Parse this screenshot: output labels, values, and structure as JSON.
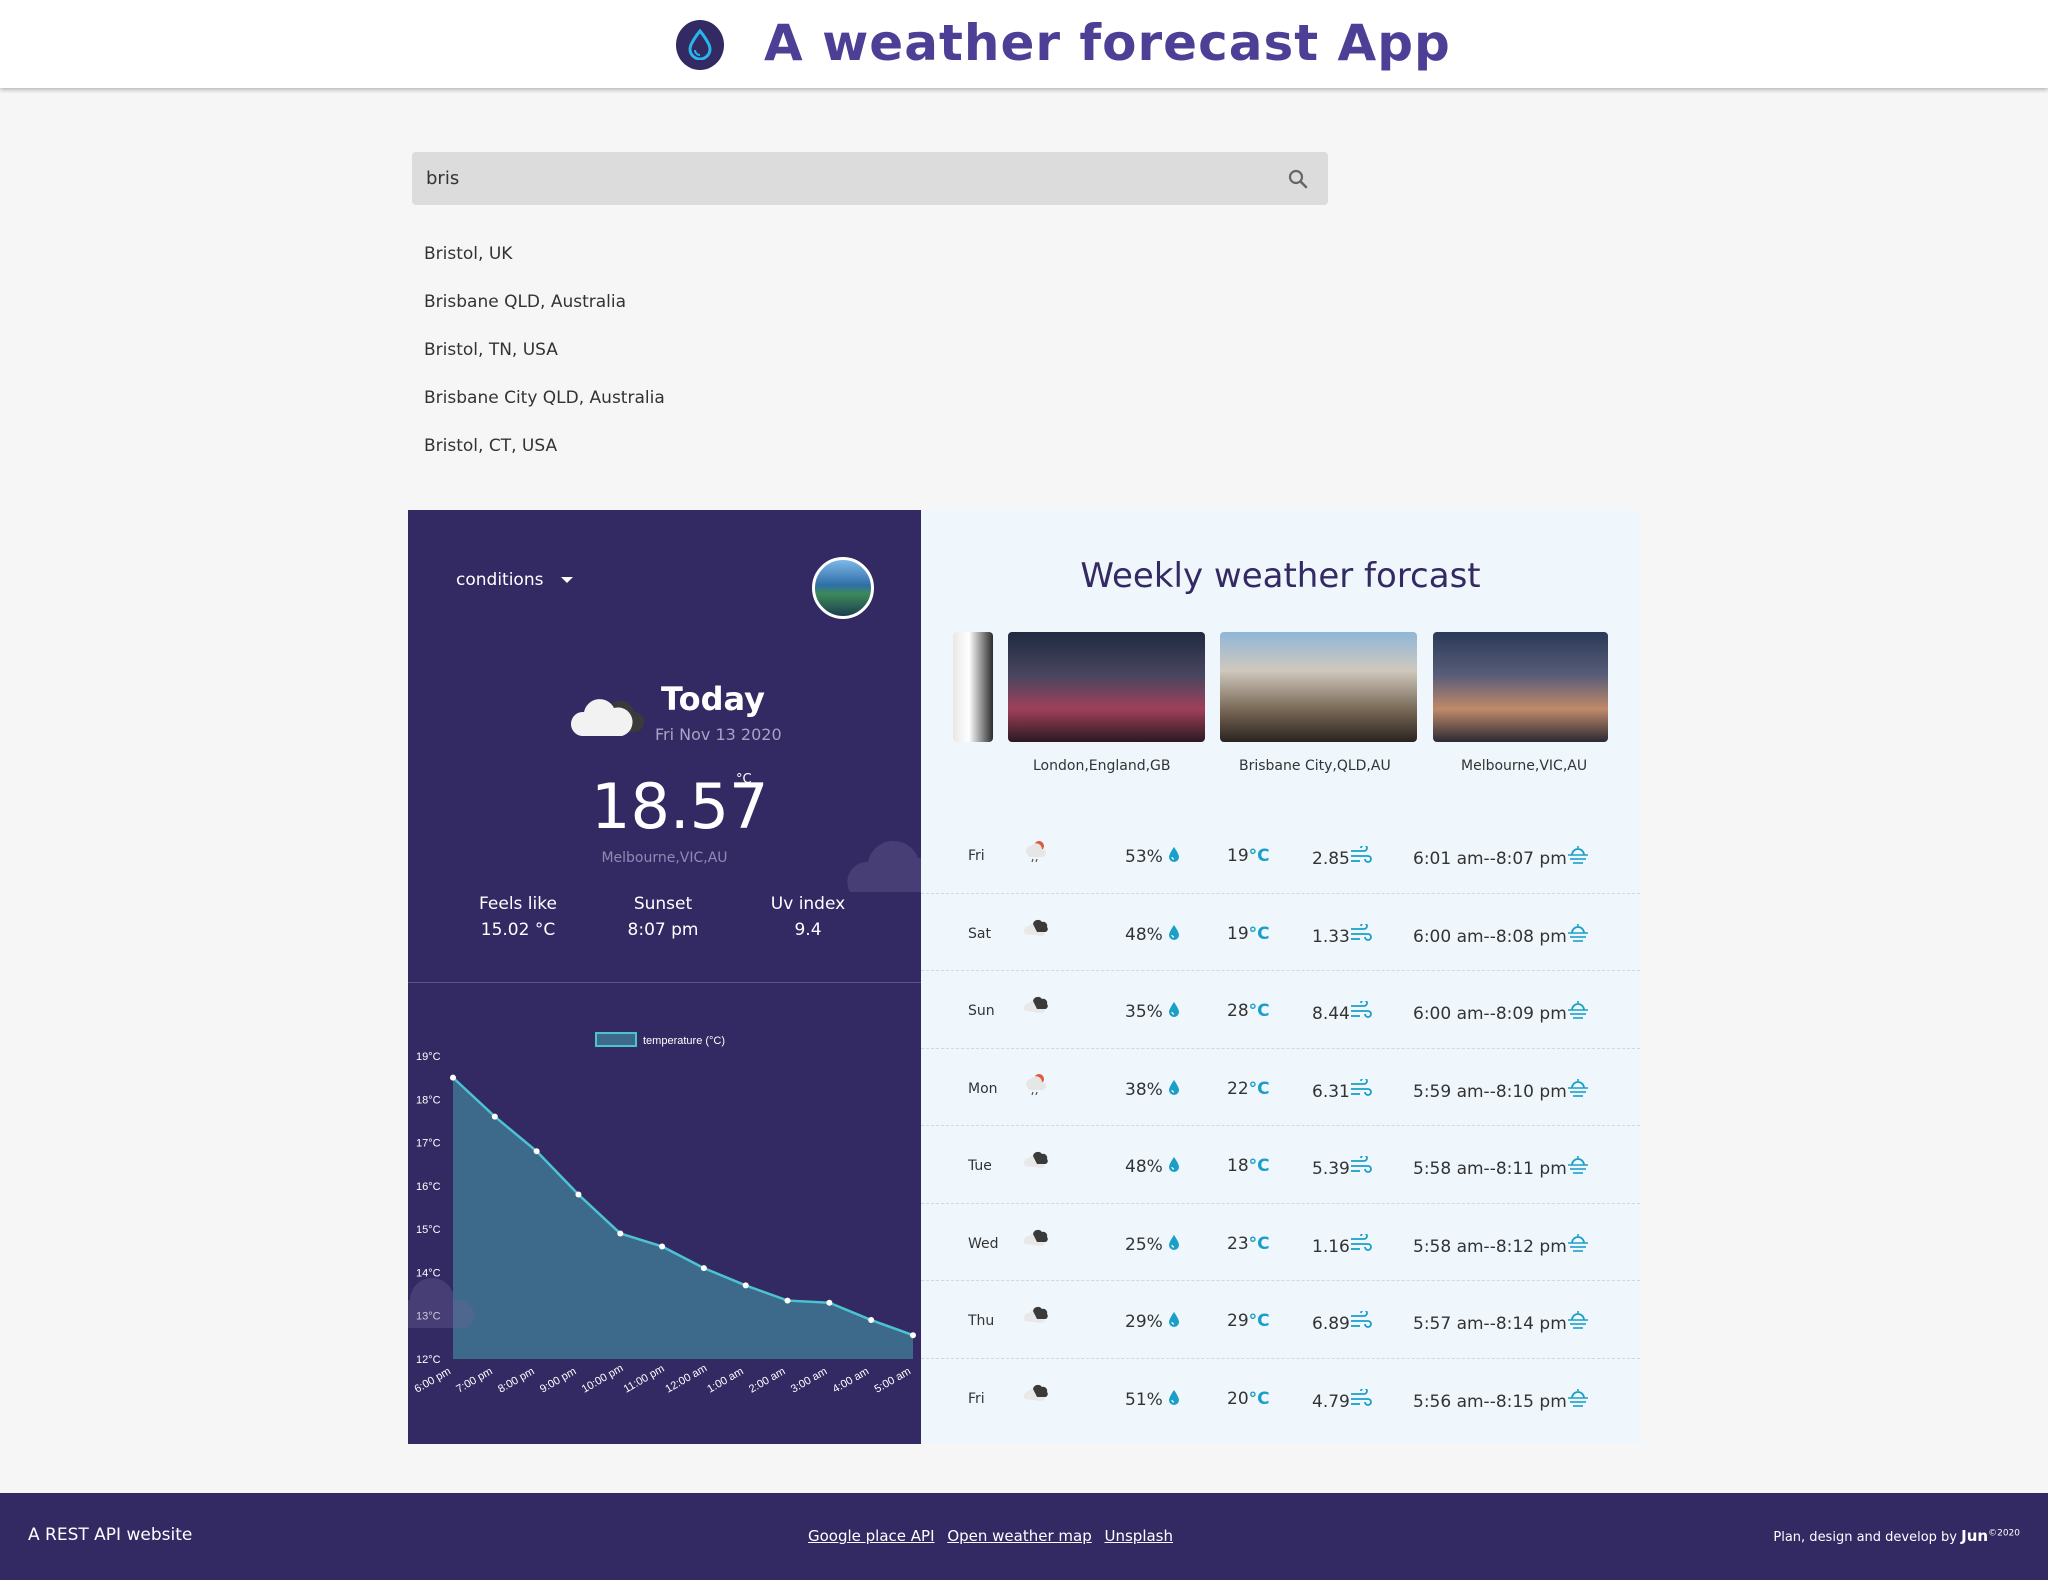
{
  "header": {
    "title": "A weather forecast App"
  },
  "search": {
    "value": "bris",
    "placeholder": ""
  },
  "suggestions": [
    "Bristol, UK",
    "Brisbane QLD, Australia",
    "Bristol, TN, USA",
    "Brisbane City QLD, Australia",
    "Bristol, CT, USA"
  ],
  "current": {
    "dropdown_label": "conditions",
    "today_label": "Today",
    "date": "Fri Nov 13 2020",
    "temperature": "18.57",
    "temperature_unit": "°C",
    "city": "Melbourne,VIC,AU",
    "stats": [
      {
        "label": "Feels like",
        "value": "15.02 °C"
      },
      {
        "label": "Sunset",
        "value": "8:07 pm"
      },
      {
        "label": "Uv index",
        "value": "9.4"
      }
    ]
  },
  "chart_data": {
    "type": "area",
    "legend": "temperature (°C)",
    "legend_position": "top",
    "series": [
      {
        "name": "temperature (°C)",
        "values": [
          18.5,
          17.6,
          16.8,
          15.8,
          14.9,
          14.6,
          14.1,
          13.7,
          13.35,
          13.3,
          12.9,
          12.55
        ]
      }
    ],
    "x": [
      "6:00 pm",
      "7:00 pm",
      "8:00 pm",
      "9:00 pm",
      "10:00 pm",
      "11:00 pm",
      "12:00 am",
      "1:00 am",
      "2:00 am",
      "3:00 am",
      "4:00 am",
      "5:00 am"
    ],
    "y_ticks": [
      "12°C",
      "13°C",
      "14°C",
      "15°C",
      "16°C",
      "17°C",
      "18°C",
      "19°C"
    ],
    "ylim": [
      12,
      19
    ],
    "colors": {
      "line": "#4cc3d0",
      "fill": "#3d6a8a"
    }
  },
  "weekly": {
    "title": "Weekly weather forcast",
    "cities": [
      "London,England,GB",
      "Brisbane City,QLD,AU",
      "Melbourne,VIC,AU"
    ],
    "rows": [
      {
        "day": "Fri",
        "icon": "rain-cloud-icon",
        "humidity": "53%",
        "temp": "19",
        "wind": "2.85",
        "sun": "6:01 am--8:07 pm"
      },
      {
        "day": "Sat",
        "icon": "cloud-icon",
        "humidity": "48%",
        "temp": "19",
        "wind": "1.33",
        "sun": "6:00 am--8:08 pm"
      },
      {
        "day": "Sun",
        "icon": "cloud-icon",
        "humidity": "35%",
        "temp": "28",
        "wind": "8.44",
        "sun": "6:00 am--8:09 pm"
      },
      {
        "day": "Mon",
        "icon": "rain-cloud-icon",
        "humidity": "38%",
        "temp": "22",
        "wind": "6.31",
        "sun": "5:59 am--8:10 pm"
      },
      {
        "day": "Tue",
        "icon": "cloud-icon",
        "humidity": "48%",
        "temp": "18",
        "wind": "5.39",
        "sun": "5:58 am--8:11 pm"
      },
      {
        "day": "Wed",
        "icon": "cloud-icon",
        "humidity": "25%",
        "temp": "23",
        "wind": "1.16",
        "sun": "5:58 am--8:12 pm"
      },
      {
        "day": "Thu",
        "icon": "cloud-icon",
        "humidity": "29%",
        "temp": "29",
        "wind": "6.89",
        "sun": "5:57 am--8:14 pm"
      },
      {
        "day": "Fri",
        "icon": "cloud-icon",
        "humidity": "51%",
        "temp": "20",
        "wind": "4.79",
        "sun": "5:56 am--8:15 pm"
      }
    ],
    "temp_unit": "°C"
  },
  "footer": {
    "left": "A REST API website",
    "links": [
      "Google place API",
      "Open weather map",
      "Unsplash"
    ],
    "credit": "Plan, design and develop by",
    "brand": "Jun",
    "year": "©2020"
  },
  "colors": {
    "brand": "#4d3f95",
    "panel": "#332a63",
    "accent": "#1b9fc7"
  }
}
